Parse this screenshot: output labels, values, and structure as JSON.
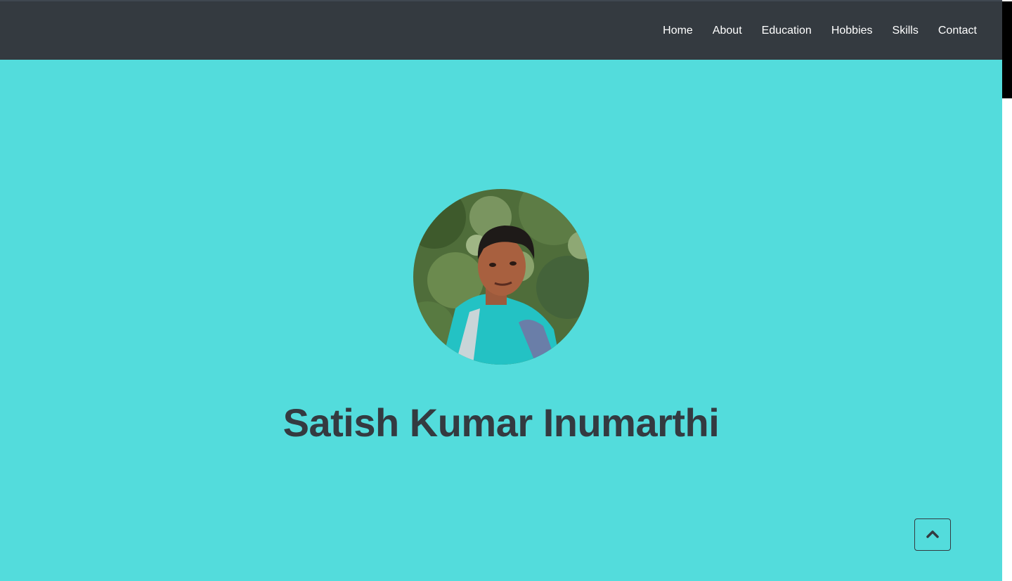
{
  "nav": {
    "items": [
      {
        "label": "Home"
      },
      {
        "label": "About"
      },
      {
        "label": "Education"
      },
      {
        "label": "Hobbies"
      },
      {
        "label": "Skills"
      },
      {
        "label": "Contact"
      }
    ]
  },
  "hero": {
    "name": "Satish Kumar Inumarthi",
    "photo_icon": "profile-photo"
  },
  "back_to_top": {
    "icon": "chevron-up-icon"
  },
  "colors": {
    "navbar_bg": "#343a40",
    "hero_bg": "#53dcdc",
    "text_dark": "#343a40"
  }
}
